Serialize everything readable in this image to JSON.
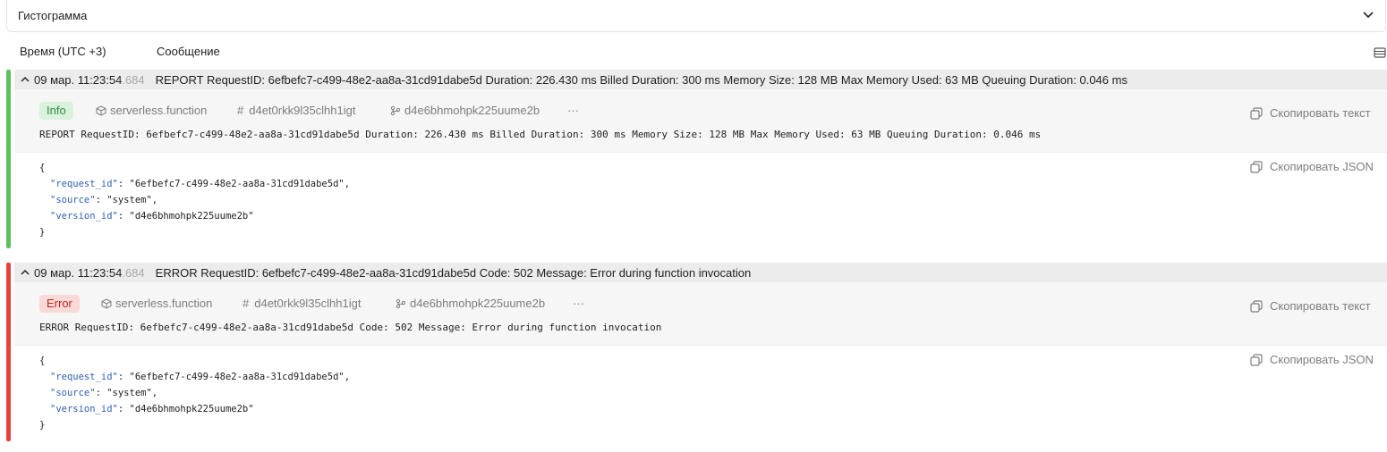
{
  "histogram": {
    "title": "Гистограмма"
  },
  "headers": {
    "time": "Время (UTC +3)",
    "message": "Сообщение"
  },
  "entries": [
    {
      "level": "Info",
      "level_color": "#5cc05d",
      "date_time": "09 мар. 11:23:54",
      "ms": ".684",
      "message": "REPORT RequestID: 6efbefc7-c499-48e2-aa8a-31cd91dabe5d Duration: 226.430 ms Billed Duration: 300 ms Memory Size: 128 MB Max Memory Used: 63 MB Queuing Duration: 0.046 ms",
      "resource_type": "serverless.function",
      "resource_id": "d4et0rkk9l35clhh1igt",
      "version": "d4e6bhmohpk225uume2b",
      "more": "···",
      "copy_text": "Скопировать текст",
      "copy_json": "Скопировать JSON",
      "json_lines": {
        "open": "{",
        "request_id_key": "\"request_id\"",
        "request_id_val": ": \"6efbefc7-c499-48e2-aa8a-31cd91dabe5d\",",
        "source_key": "\"source\"",
        "source_val": ": \"system\",",
        "version_key": "\"version_id\"",
        "version_val": ": \"d4e6bhmohpk225uume2b\"",
        "close": "}"
      }
    },
    {
      "level": "Error",
      "level_color": "#e5423c",
      "date_time": "09 мар. 11:23:54",
      "ms": ".684",
      "message": "ERROR RequestID: 6efbefc7-c499-48e2-aa8a-31cd91dabe5d Code: 502 Message: Error during function invocation",
      "resource_type": "serverless.function",
      "resource_id": "d4et0rkk9l35clhh1igt",
      "version": "d4e6bhmohpk225uume2b",
      "more": "···",
      "copy_text": "Скопировать текст",
      "copy_json": "Скопировать JSON",
      "json_lines": {
        "open": "{",
        "request_id_key": "\"request_id\"",
        "request_id_val": ": \"6efbefc7-c499-48e2-aa8a-31cd91dabe5d\",",
        "source_key": "\"source\"",
        "source_val": ": \"system\",",
        "version_key": "\"version_id\"",
        "version_val": ": \"d4e6bhmohpk225uume2b\"",
        "close": "}"
      }
    }
  ]
}
